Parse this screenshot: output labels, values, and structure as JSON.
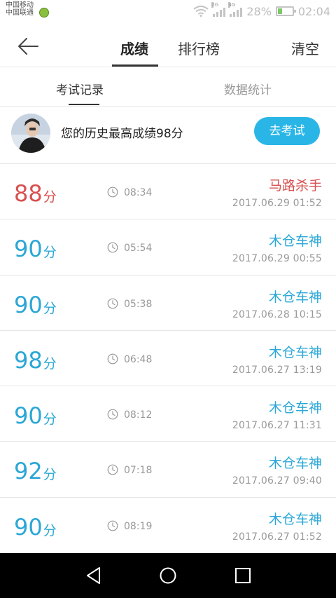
{
  "status_bar": {
    "carrier1": "中国移动",
    "carrier2": "中国联通",
    "network1": "2G",
    "network2": "4G",
    "battery": "28%",
    "battery_level": 0.28,
    "time": "02:04"
  },
  "header": {
    "tab_score": "成绩",
    "tab_rank": "排行榜",
    "clear": "清空"
  },
  "subtabs": {
    "records": "考试记录",
    "stats": "数据统计"
  },
  "best": {
    "text": "您的历史最高成绩98分",
    "exam_button": "去考试"
  },
  "records": [
    {
      "score": "88",
      "unit": "分",
      "duration": "08:34",
      "name": "马路杀手",
      "date": "2017.06.29  01:52",
      "color": "#d85050"
    },
    {
      "score": "90",
      "unit": "分",
      "duration": "05:54",
      "name": "木仓车神",
      "date": "2017.06.29  00:55",
      "color": "#2aa7d6"
    },
    {
      "score": "90",
      "unit": "分",
      "duration": "05:38",
      "name": "木仓车神",
      "date": "2017.06.28  10:15",
      "color": "#2aa7d6"
    },
    {
      "score": "98",
      "unit": "分",
      "duration": "06:48",
      "name": "木仓车神",
      "date": "2017.06.27  13:19",
      "color": "#2aa7d6"
    },
    {
      "score": "90",
      "unit": "分",
      "duration": "08:12",
      "name": "木仓车神",
      "date": "2017.06.27  11:31",
      "color": "#2aa7d6"
    },
    {
      "score": "92",
      "unit": "分",
      "duration": "07:18",
      "name": "木仓车神",
      "date": "2017.06.27  09:40",
      "color": "#2aa7d6"
    },
    {
      "score": "90",
      "unit": "分",
      "duration": "08:19",
      "name": "木仓车神",
      "date": "2017.06.27  01:52",
      "color": "#2aa7d6"
    }
  ],
  "colors": {
    "accent": "#29b6e6",
    "pass": "#2aa7d6",
    "fail": "#d85050"
  }
}
